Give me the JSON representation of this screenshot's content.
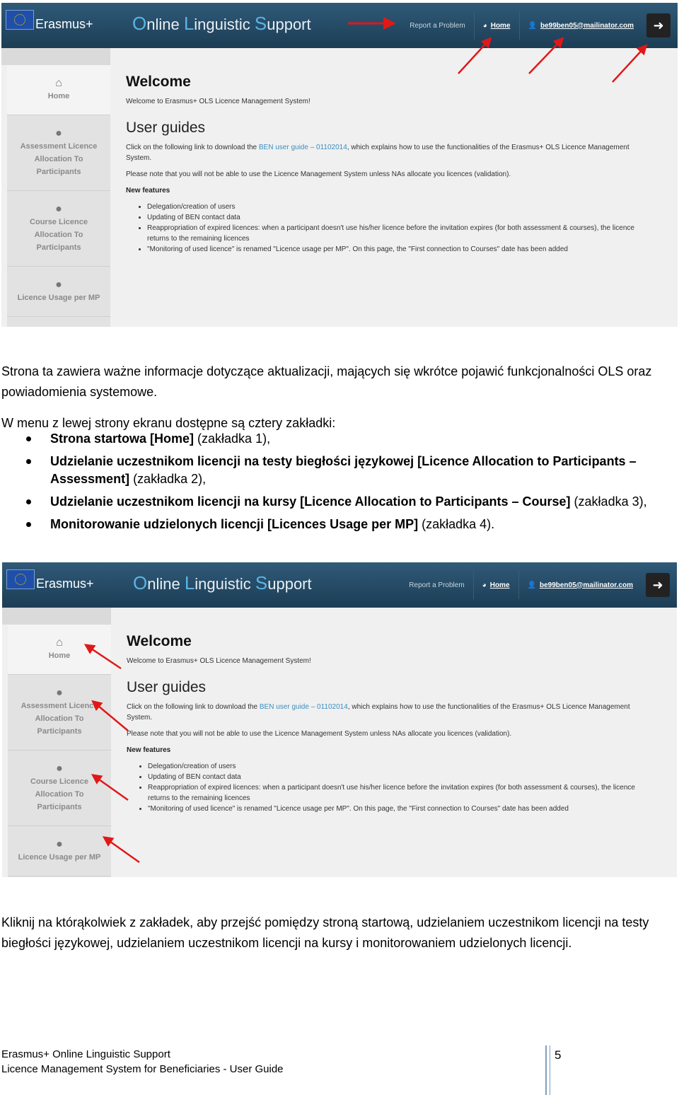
{
  "screenshot": {
    "brand": "Erasmus+",
    "title_parts": [
      "O",
      "nline ",
      "L",
      "inguistic ",
      "S",
      "upport"
    ],
    "nav": {
      "report": "Report a Problem",
      "home": "Home",
      "user": "be99ben05@mailinator.com"
    },
    "sidebar": [
      {
        "label": "Home",
        "icon": "home-icon"
      },
      {
        "label": "Assessment Licence Allocation To Participants",
        "icon": "award-icon"
      },
      {
        "label": "Course Licence Allocation To Participants",
        "icon": "award-icon"
      },
      {
        "label": "Licence Usage per MP",
        "icon": "award-icon"
      }
    ],
    "welcome": "Welcome",
    "welcome_sub": "Welcome to Erasmus+ OLS Licence Management System!",
    "guides_title": "User guides",
    "guide_pre": "Click on the following link to download the ",
    "guide_link": "BEN user guide – 01102014",
    "guide_post": ", which explains how to use the functionalities of the Erasmus+ OLS Licence Management System.",
    "note": "Please note that you will not be able to use the Licence Management System unless NAs allocate you licences (validation).",
    "new_features": "New features",
    "features": [
      "Delegation/creation of users",
      "Updating of BEN contact data",
      "Reappropriation of expired licences: when a participant doesn't use his/her licence before the invitation expires (for both assessment & courses), the licence returns to the remaining licences",
      "\"Monitoring of used licence\" is renamed \"Licence usage per MP\". On this page, the \"First connection to Courses\" date has been added"
    ],
    "arrow_color": "#e01818"
  },
  "doc": {
    "para1": "Strona ta zawiera ważne informacje dotyczące aktualizacji, mających się wkrótce pojawić funkcjonalności OLS oraz powiadomienia systemowe.",
    "para2": "W menu z lewej strony ekranu dostępne są cztery zakładki:",
    "bullets": [
      {
        "bold": "Strona startowa [Home]",
        "rest": " (zakładka 1),"
      },
      {
        "bold": "Udzielanie uczestnikom licencji na testy biegłości językowej [Licence Allocation to Participants – Assessment]",
        "rest": " (zakładka 2),"
      },
      {
        "bold": "Udzielanie uczestnikom licencji na kursy [Licence Allocation to Participants – Course]",
        "rest": " (zakładka 3),"
      },
      {
        "bold": "Monitorowanie udzielonych licencji [Licences Usage per MP]",
        "rest": " (zakładka 4)."
      }
    ],
    "para3": "Kliknij na którąkolwiek z zakładek, aby przejść pomiędzy stroną startową, udzielaniem uczestnikom licencji na testy biegłości językowej, udzielaniem uczestnikom licencji na kursy i monitorowaniem udzielonych licencji."
  },
  "footer": {
    "line1": "Erasmus+ Online Linguistic Support",
    "line2": "Licence Management System for Beneficiaries - User Guide",
    "page": "5"
  }
}
